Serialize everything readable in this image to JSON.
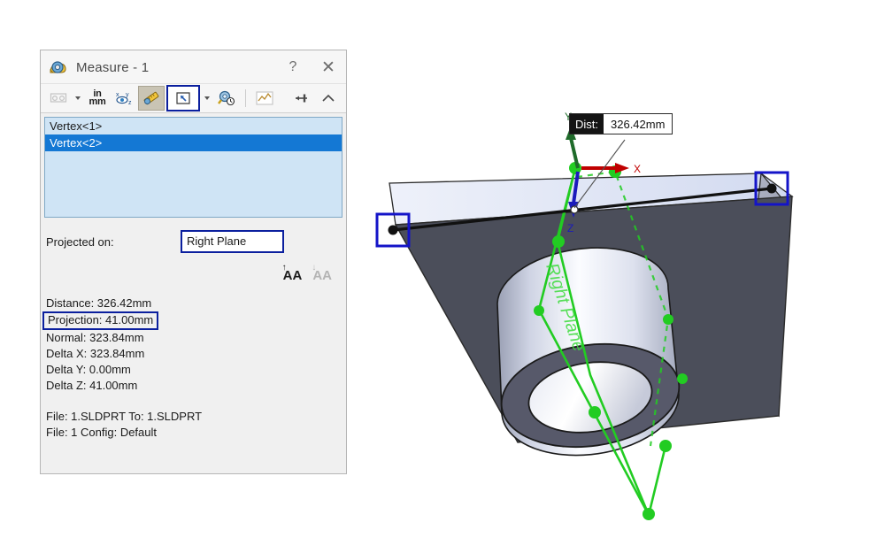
{
  "window": {
    "title": "Measure - 1",
    "icon": "measure-tape-icon",
    "help_label": "?",
    "close_label": "✕",
    "pin_label": "pin-icon",
    "collapse_label": "chevron-up-icon"
  },
  "toolbar": {
    "items": [
      {
        "name": "arc-condition-button",
        "label": "arc-condition-icon",
        "state": "disabled",
        "has_caret": true
      },
      {
        "name": "units-settings-button",
        "label": "in\nmm",
        "state": "normal",
        "has_caret": false
      },
      {
        "name": "xyz-display-button",
        "label": "xyz-icon",
        "state": "normal",
        "has_caret": false
      },
      {
        "name": "show-xyz-measurements-button",
        "label": "ruler-icon",
        "state": "active",
        "has_caret": false
      },
      {
        "name": "projected-on-button",
        "label": "projected-plane-icon",
        "state": "selected",
        "has_caret": true
      },
      {
        "name": "measure-history-button",
        "label": "magnifier-clock-icon",
        "state": "normal",
        "has_caret": false
      },
      {
        "name": "sensor-chart-button",
        "label": "chart-icon",
        "state": "disabled",
        "has_caret": false
      }
    ],
    "units_line1": "in",
    "units_line2": "mm"
  },
  "selection_list": {
    "items": [
      {
        "label": "Vertex<1>",
        "selected": false
      },
      {
        "label": "Vertex<2>",
        "selected": true
      }
    ]
  },
  "projected_on": {
    "label": "Projected on:",
    "value": "Right Plane"
  },
  "font_controls": {
    "increase_label": "A",
    "increase_badge": "↑",
    "decrease_label": "A",
    "decrease_badge": "↓"
  },
  "results": {
    "lines": [
      {
        "text": "Distance: 326.42mm",
        "boxed": false
      },
      {
        "text": "Projection: 41.00mm",
        "boxed": true
      },
      {
        "text": "Normal: 323.84mm",
        "boxed": false
      },
      {
        "text": "Delta X: 323.84mm",
        "boxed": false
      },
      {
        "text": "Delta Y: 0.00mm",
        "boxed": false
      },
      {
        "text": "Delta Z: 41.00mm",
        "boxed": false
      }
    ],
    "file_line_1": "File: 1.SLDPRT To: 1.SLDPRT",
    "file_line_2": "File: 1 Config: Default"
  },
  "viewport": {
    "callout": {
      "label": "Dist:",
      "value": "326.42mm"
    },
    "plane_label": "Right Plane",
    "triad": {
      "x_label": "X",
      "y_label": "Y",
      "z_label": "Z"
    },
    "selected_vertex_1": "vertex-1-highlight",
    "selected_vertex_2": "vertex-2-highlight"
  },
  "colors": {
    "accent_blue": "#0b1f9e",
    "selection_blue": "#1478d4",
    "list_bg": "#cfe4f5",
    "plane_green": "#22cc22",
    "part_dark": "#4b4e5a",
    "part_top": "#dfe5f5",
    "part_side": "#8e93a8",
    "axis_x": "#c00000",
    "axis_y": "#1f6b2a",
    "axis_z": "#1b1bbb"
  }
}
